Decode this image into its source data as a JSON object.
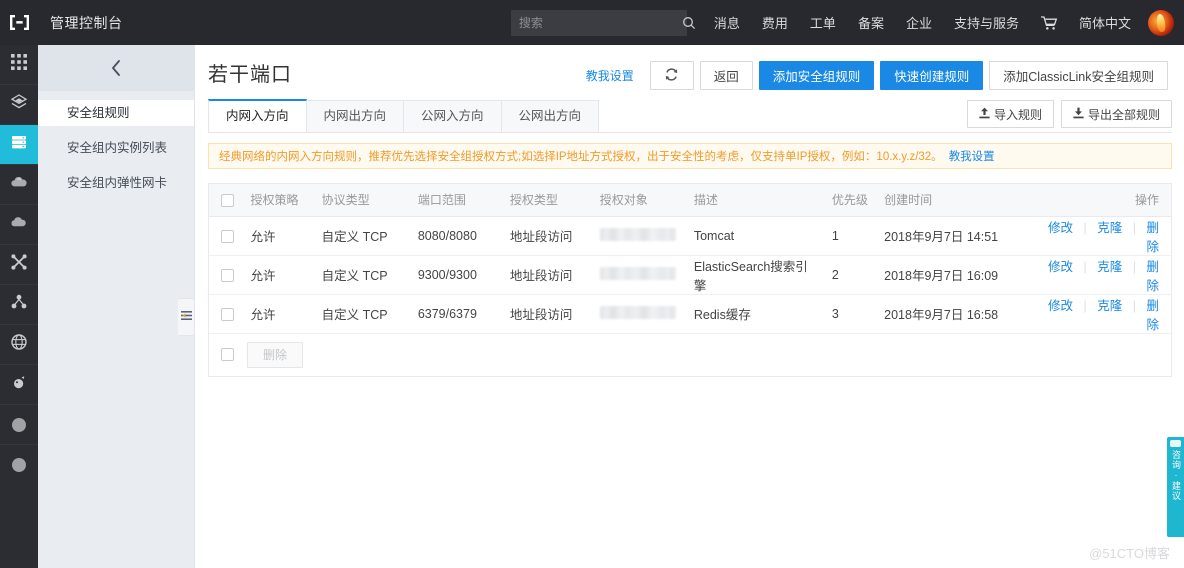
{
  "header": {
    "logo_icon": "console-bracket-logo",
    "title": "管理控制台",
    "search": {
      "placeholder": "搜索",
      "icon": "search-icon"
    },
    "nav": [
      {
        "label": "消息"
      },
      {
        "label": "费用"
      },
      {
        "label": "工单"
      },
      {
        "label": "备案"
      },
      {
        "label": "企业"
      },
      {
        "label": "支持与服务"
      }
    ],
    "cart_icon": "shopping-cart-icon",
    "language": "简体中文",
    "avatar_icon": "user-avatar"
  },
  "icon_rail": {
    "items": [
      {
        "icon": "apps-grid-icon",
        "active": false
      },
      {
        "icon": "layers-icon",
        "active": false
      },
      {
        "icon": "server-icon",
        "active": true
      },
      {
        "icon": "cloud-upload-icon",
        "active": false
      },
      {
        "icon": "cloud-database-icon",
        "active": false
      },
      {
        "icon": "network-cross-icon",
        "active": false
      },
      {
        "icon": "hierarchy-icon",
        "active": false
      },
      {
        "icon": "globe-icon",
        "active": false
      },
      {
        "icon": "security-shield-icon",
        "active": false
      },
      {
        "icon": "circle-icon",
        "active": false
      },
      {
        "icon": "circle-icon",
        "active": false
      }
    ]
  },
  "submenu": {
    "collapse_icon": "chevron-left-icon",
    "items": [
      {
        "label": "安全组规则",
        "active": true
      },
      {
        "label": "安全组内实例列表",
        "active": false
      },
      {
        "label": "安全组内弹性网卡",
        "active": false
      }
    ],
    "handle_icon": "panel-toggle-icon"
  },
  "page": {
    "title": "若干端口",
    "teach_link": "教我设置",
    "refresh_icon": "refresh-icon",
    "buttons": {
      "back": "返回",
      "add_rule": "添加安全组规则",
      "quick_create": "快速创建规则",
      "add_classiclink": "添加ClassicLink安全组规则"
    }
  },
  "tabs": [
    {
      "label": "内网入方向",
      "active": true
    },
    {
      "label": "内网出方向",
      "active": false
    },
    {
      "label": "公网入方向",
      "active": false
    },
    {
      "label": "公网出方向",
      "active": false
    }
  ],
  "tab_actions": {
    "import": {
      "label": "导入规则",
      "icon": "upload-icon"
    },
    "export": {
      "label": "导出全部规则",
      "icon": "download-icon"
    }
  },
  "notice": {
    "text": "经典网络的内网入方向规则，推荐优先选择安全组授权方式;如选择IP地址方式授权，出于安全性的考虑，仅支持单IP授权，例如：10.x.y.z/32。",
    "link": "教我设置",
    "accent_color": "#f09b2c",
    "background": "#fffaef"
  },
  "table": {
    "columns": [
      "授权策略",
      "协议类型",
      "端口范围",
      "授权类型",
      "授权对象",
      "描述",
      "优先级",
      "创建时间",
      "操作"
    ],
    "rows": [
      {
        "policy": "允许",
        "protocol": "自定义 TCP",
        "port_range": "8080/8080",
        "auth_type": "地址段访问",
        "auth_object": "",
        "description": "Tomcat",
        "priority": "1",
        "created": "2018年9月7日 14:51"
      },
      {
        "policy": "允许",
        "protocol": "自定义 TCP",
        "port_range": "9300/9300",
        "auth_type": "地址段访问",
        "auth_object": "",
        "description": "ElasticSearch搜索引擎",
        "priority": "2",
        "created": "2018年9月7日 16:09"
      },
      {
        "policy": "允许",
        "protocol": "自定义 TCP",
        "port_range": "6379/6379",
        "auth_type": "地址段访问",
        "auth_object": "",
        "description": "Redis缓存",
        "priority": "3",
        "created": "2018年9月7日 16:58"
      }
    ],
    "ops": {
      "edit": "修改",
      "clone": "克隆",
      "delete": "删除"
    },
    "footer": {
      "delete_button": "删除"
    }
  },
  "feedback_tab": {
    "text": "咨询·建议",
    "color": "#1fb6cf"
  },
  "watermark": "@51CTO博客"
}
